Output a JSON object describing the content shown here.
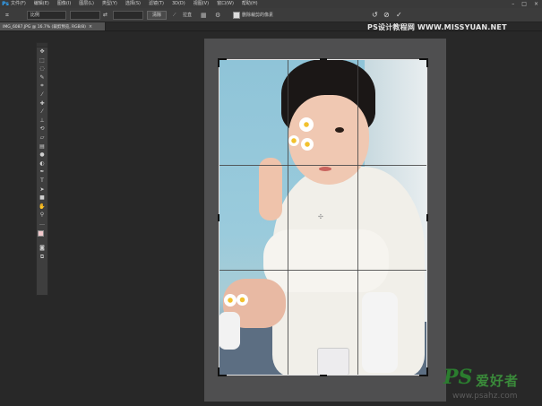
{
  "app": {
    "logo": "Ps"
  },
  "menu": {
    "items": [
      "文件(F)",
      "编辑(E)",
      "图像(I)",
      "图层(L)",
      "类型(Y)",
      "选择(S)",
      "滤镜(T)",
      "3D(D)",
      "视图(V)",
      "窗口(W)",
      "帮助(H)"
    ],
    "window_controls": [
      "–",
      "□",
      "×"
    ]
  },
  "options_bar": {
    "ratio_value": "比例",
    "swap_glyph": "⇄",
    "clear_label": "清除",
    "straighten_label": "拉直",
    "delete_cropped_label": "删除裁剪的像素",
    "delete_cropped_checked": true
  },
  "document": {
    "tab_title": "IMG_6087.JPG @ 16.7% (裁剪预览, RGB/8)",
    "close_glyph": "×"
  },
  "watermarks": {
    "top": "PS设计教程网 WWW.MISSYUAN.NET",
    "bottom_ps": "PS",
    "bottom_cn": "爱好者",
    "bottom_url": "www.psahz.com"
  },
  "toolbox": {
    "tools": [
      {
        "icon": "move-icon",
        "glyph": "✥"
      },
      {
        "icon": "marquee-icon",
        "glyph": "⬚"
      },
      {
        "icon": "lasso-icon",
        "glyph": "◌"
      },
      {
        "icon": "quick-select-icon",
        "glyph": "✎"
      },
      {
        "icon": "crop-icon",
        "glyph": "⌗"
      },
      {
        "icon": "eyedropper-icon",
        "glyph": "⁄"
      },
      {
        "icon": "healing-brush-icon",
        "glyph": "✚"
      },
      {
        "icon": "brush-icon",
        "glyph": "⁄"
      },
      {
        "icon": "clone-stamp-icon",
        "glyph": "⊥"
      },
      {
        "icon": "history-brush-icon",
        "glyph": "⟲"
      },
      {
        "icon": "eraser-icon",
        "glyph": "▱"
      },
      {
        "icon": "gradient-icon",
        "glyph": "▤"
      },
      {
        "icon": "blur-icon",
        "glyph": "●"
      },
      {
        "icon": "dodge-icon",
        "glyph": "◐"
      },
      {
        "icon": "pen-icon",
        "glyph": "✒"
      },
      {
        "icon": "type-icon",
        "glyph": "T"
      },
      {
        "icon": "path-select-icon",
        "glyph": "➤"
      },
      {
        "icon": "shape-icon",
        "glyph": "■"
      },
      {
        "icon": "hand-icon",
        "glyph": "✋"
      },
      {
        "icon": "zoom-icon",
        "glyph": "⚲"
      },
      {
        "icon": "extra-icon",
        "glyph": "…"
      }
    ],
    "foreground_color": "#f1c9cc",
    "background_color": "#111111",
    "quick_mask_glyph": "◙",
    "screen_mode_glyph": "⧉"
  },
  "icons": {
    "crop_tool": "⌗",
    "straighten": "⟋",
    "grid_overlay": "▦",
    "settings": "⚙",
    "undo": "↺",
    "cancel": "⊘",
    "commit": "✓"
  }
}
